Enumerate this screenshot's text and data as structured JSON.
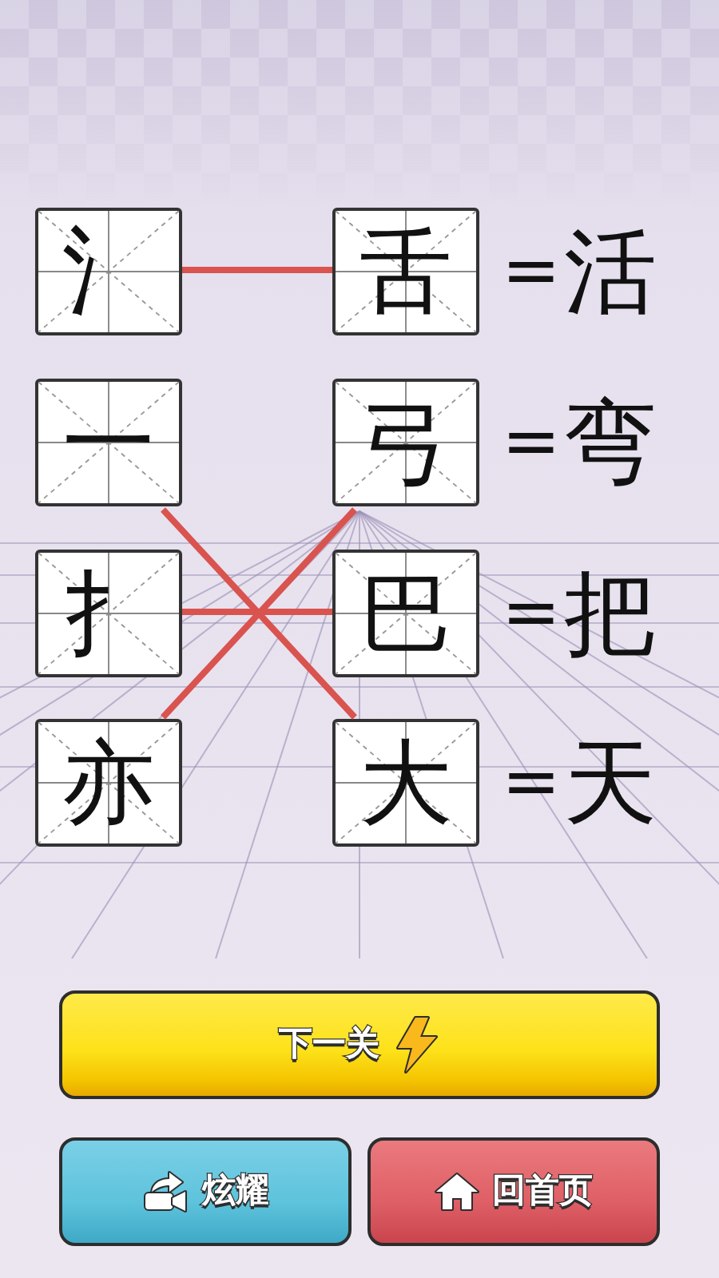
{
  "rows": [
    {
      "radical": "氵",
      "kind": "across",
      "component": "舌",
      "equals": "=",
      "result": "活"
    },
    {
      "radical": "一",
      "kind": "down2",
      "component": "弓",
      "equals": "=",
      "result": "弯"
    },
    {
      "radical": "扌",
      "kind": "across",
      "component": "巴",
      "equals": "=",
      "result": "把"
    },
    {
      "radical": "亦",
      "kind": "up2",
      "component": "大",
      "equals": "=",
      "result": "天"
    }
  ],
  "buttons": [
    {
      "kind": "next",
      "label": "下一关"
    },
    {
      "kind": "share",
      "label": "炫耀"
    },
    {
      "kind": "home",
      "label": "回首页"
    }
  ]
}
